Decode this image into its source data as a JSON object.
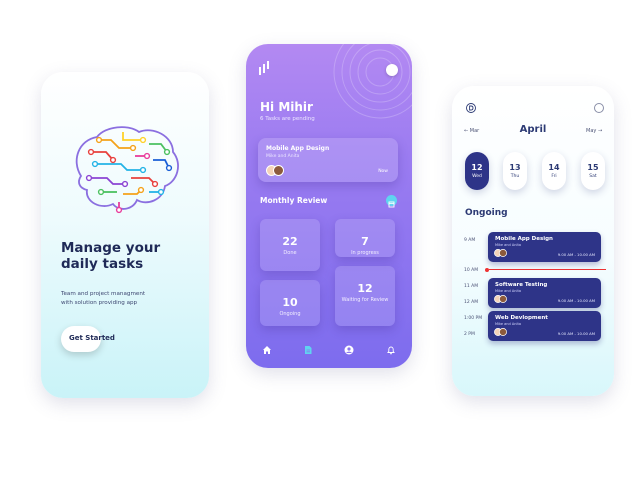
{
  "onboarding": {
    "headline_line1": "Manage your",
    "headline_line2": "daily tasks",
    "subtitle_line1": "Team and project managment",
    "subtitle_line2": "with solution providing app",
    "cta_label": "Get Started",
    "illustration": "brain-circuit-icon"
  },
  "dashboard": {
    "greeting": "Hi Mihir",
    "pending": "6 Tasks are pending",
    "task": {
      "title": "Mobile App Design",
      "subtitle": "Mike and Anita",
      "time": "Now"
    },
    "review_title": "Monthly Review",
    "cards": [
      {
        "value": "22",
        "label": "Done"
      },
      {
        "value": "7",
        "label": "In progress"
      },
      {
        "value": "10",
        "label": "Ongoing"
      },
      {
        "value": "12",
        "label": "Waiting for Review"
      }
    ],
    "nav": [
      "home-icon",
      "document-icon",
      "profile-icon",
      "bell-icon"
    ]
  },
  "schedule": {
    "prev_month": "Mar",
    "month": "April",
    "next_month": "May",
    "days": [
      {
        "num": "12",
        "weekday": "Wed",
        "active": true
      },
      {
        "num": "13",
        "weekday": "Thu"
      },
      {
        "num": "14",
        "weekday": "Fri"
      },
      {
        "num": "15",
        "weekday": "Sat"
      }
    ],
    "section": "Ongoing",
    "times": [
      "9 AM",
      "10 AM",
      "11 AM",
      "12 AM",
      "1:00 PM",
      "2 PM"
    ],
    "events": [
      {
        "title": "Mobile App Design",
        "subtitle": "Mike and Anita",
        "time": "9.00 AM - 10.00 AM"
      },
      {
        "title": "Software Testing",
        "subtitle": "Mike and Anita",
        "time": "9.00 AM - 10.00 AM"
      },
      {
        "title": "Web Devlopment",
        "subtitle": "Mike and Anita",
        "time": "9.00 AM - 10.00 AM"
      }
    ]
  },
  "colors": {
    "navy": "#2e3488",
    "purple_top": "#b389f2",
    "purple_bottom": "#7d6cee",
    "cyan": "#c9f3f8",
    "accent_blue": "#5fd4f0",
    "now_line": "#e33333"
  }
}
